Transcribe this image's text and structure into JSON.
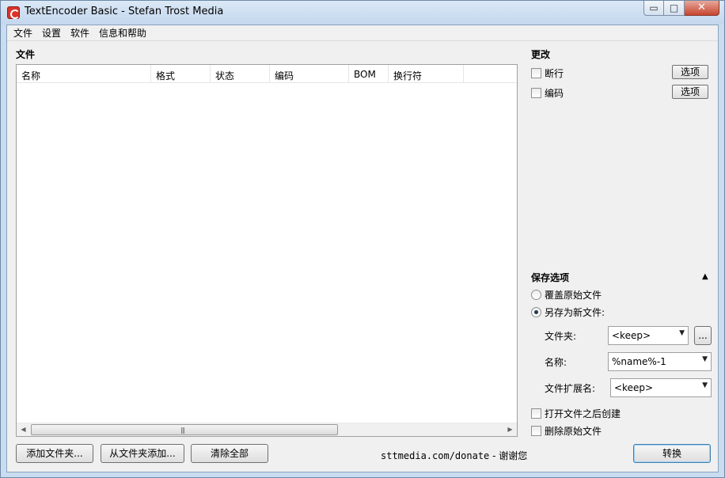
{
  "window": {
    "title": "TextEncoder Basic - Stefan Trost Media",
    "minimize_glyph": "▭",
    "maximize_glyph": "□",
    "close_glyph": "✕"
  },
  "menu": {
    "items": [
      "文件",
      "设置",
      "软件",
      "信息和帮助"
    ]
  },
  "files": {
    "title": "文件",
    "columns": [
      "名称",
      "格式",
      "状态",
      "编码",
      "BOM",
      "换行符"
    ],
    "scroll_left_glyph": "◀",
    "scroll_right_glyph": "▶",
    "scroll_grip_glyph": "|||"
  },
  "changes": {
    "title": "更改",
    "items": [
      {
        "label": "断行",
        "checked": false,
        "button": "选项"
      },
      {
        "label": "编码",
        "checked": false,
        "button": "选项"
      }
    ]
  },
  "save": {
    "title": "保存选项",
    "collapse_glyph": "▲",
    "overwrite_label": "覆盖原始文件",
    "save_as_label": "另存为新文件:",
    "selected": "save_as",
    "folder_label": "文件夹:",
    "folder_value": "<keep>",
    "browse_label": "...",
    "name_label": "名称:",
    "name_value": "%name%-1",
    "ext_label": "文件扩展名:",
    "ext_value": "<keep>",
    "dropdown_glyph": "▼",
    "open_after_label": "打开文件之后创建",
    "delete_original_label": "删除原始文件"
  },
  "buttons": {
    "add_files": "添加文件夹...",
    "add_from_folder": "从文件夹添加...",
    "clear_all": "清除全部",
    "convert": "转换"
  },
  "donate": {
    "url": "sttmedia.com/donate",
    "separator": " - ",
    "thanks": "谢谢您"
  }
}
